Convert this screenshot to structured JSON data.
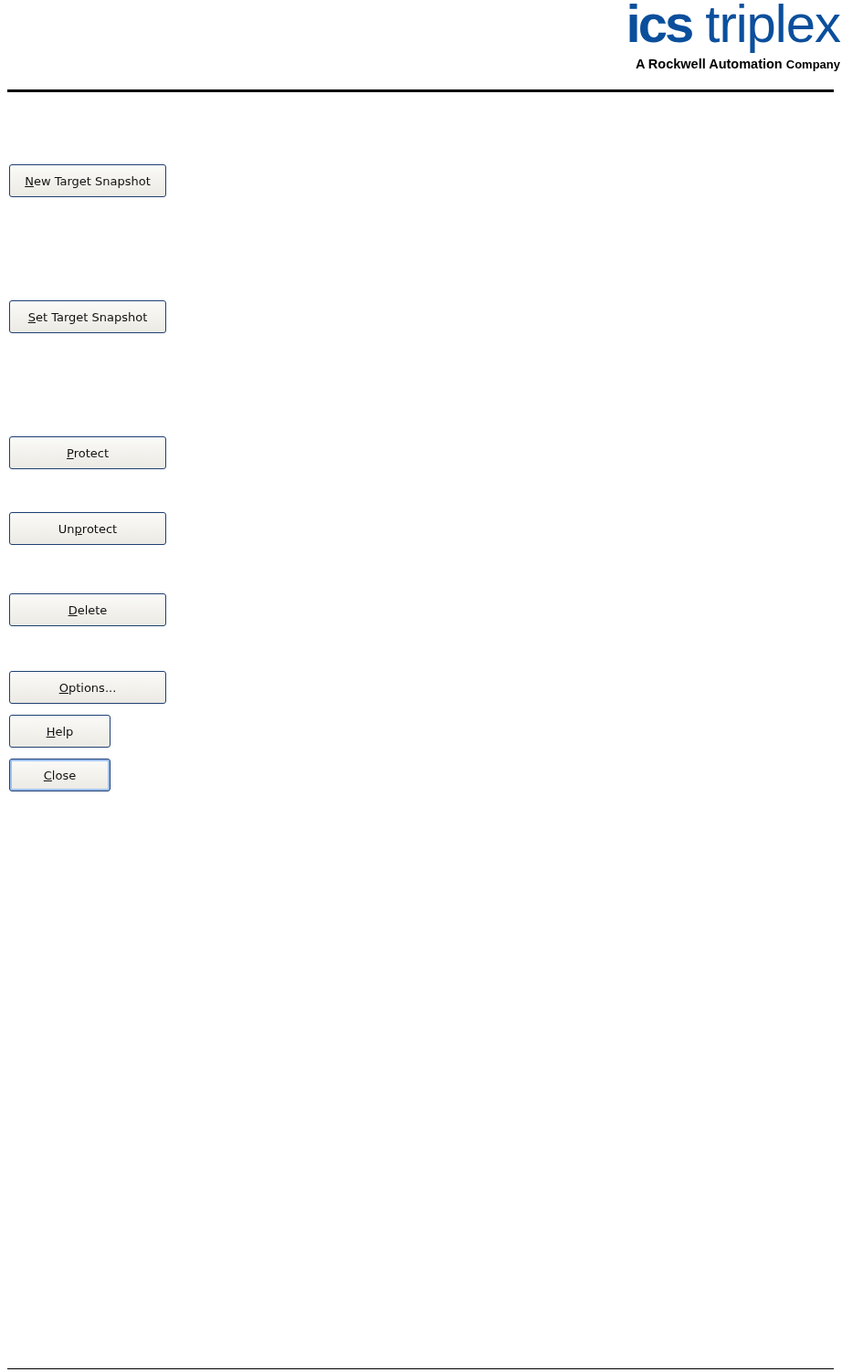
{
  "logo": {
    "brand_bold": "ics",
    "brand_light": "triplex",
    "tagline_bold": "A Rockwell Automation",
    "tagline_light": "Company"
  },
  "buttons": [
    {
      "key": "N",
      "post": "ew Target Snapshot",
      "kind": "wide",
      "focused": false
    },
    {
      "key": "S",
      "post": "et Target Snapshot",
      "kind": "wide",
      "focused": false
    },
    {
      "key": "P",
      "post": "rotect",
      "kind": "wide",
      "focused": false
    },
    {
      "pre": "Un",
      "key": "p",
      "post": "rotect",
      "kind": "wide",
      "focused": false
    },
    {
      "key": "D",
      "post": "elete",
      "kind": "wide",
      "focused": false
    },
    {
      "key": "O",
      "post": "ptions...",
      "kind": "wide",
      "focused": false
    },
    {
      "key": "H",
      "post": "elp",
      "kind": "narrow",
      "focused": false
    },
    {
      "key": "C",
      "post": "lose",
      "kind": "narrow",
      "focused": true
    }
  ]
}
